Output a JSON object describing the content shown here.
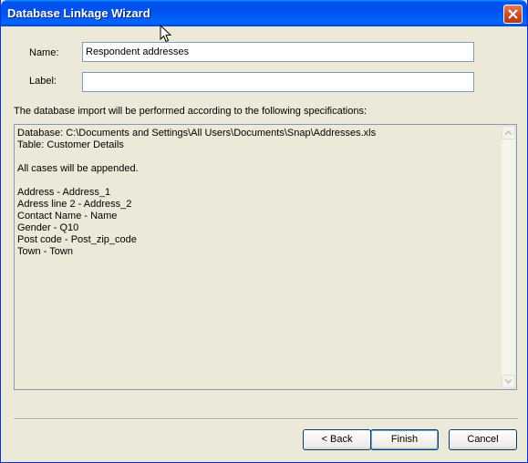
{
  "window": {
    "title": "Database Linkage Wizard"
  },
  "form": {
    "name_label": "Name:",
    "name_value": "Respondent addresses",
    "label_label": "Label:",
    "label_value": ""
  },
  "intro": "The database import will be performed according to the following specifications:",
  "specs": {
    "lines": [
      "Database: C:\\Documents and Settings\\All Users\\Documents\\Snap\\Addresses.xls",
      "Table: Customer Details",
      "",
      "All cases will be appended.",
      "",
      "Address - Address_1",
      "Adress line 2 - Address_2",
      "Contact Name - Name",
      "Gender - Q10",
      "Post code - Post_zip_code",
      "Town - Town"
    ]
  },
  "buttons": {
    "back": "< Back",
    "finish": "Finish",
    "cancel": "Cancel"
  },
  "icons": {
    "close": "close-icon",
    "cursor": "mouse-pointer-icon"
  }
}
